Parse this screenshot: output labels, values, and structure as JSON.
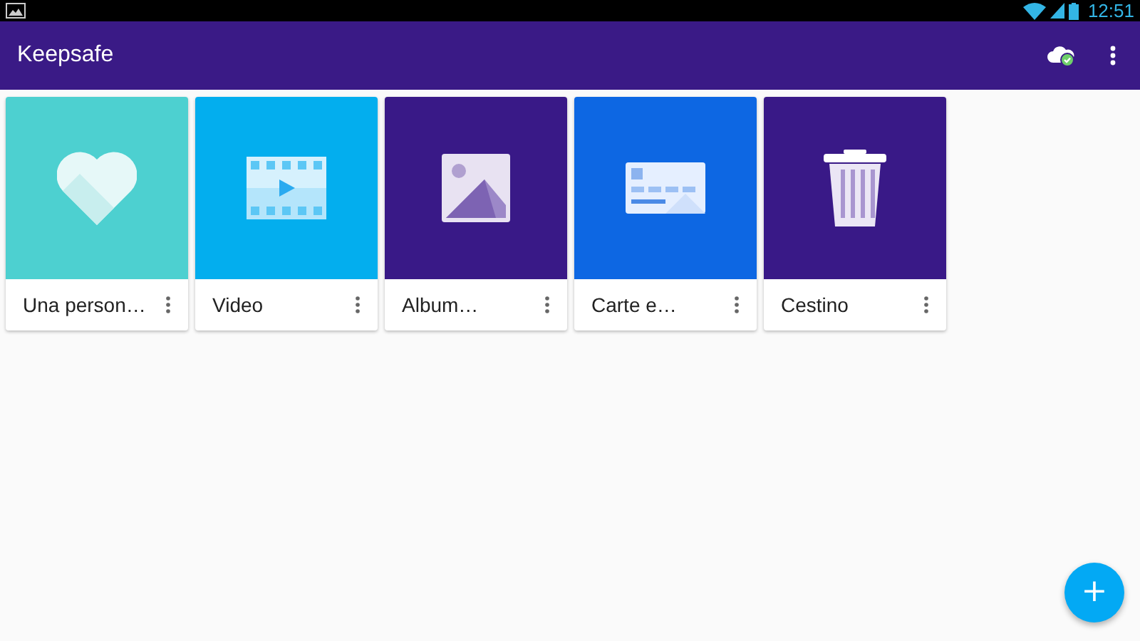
{
  "status_bar": {
    "time": "12:51"
  },
  "app_bar": {
    "title": "Keepsafe"
  },
  "albums": [
    {
      "kind": "heart",
      "title": "Una person…",
      "color": "#4dd0d0"
    },
    {
      "kind": "video",
      "title": "Video",
      "color": "#03aeee"
    },
    {
      "kind": "image",
      "title": "Album…",
      "color": "#391987"
    },
    {
      "kind": "card",
      "title": "Carte e…",
      "color": "#0d67e3"
    },
    {
      "kind": "trash",
      "title": "Cestino",
      "color": "#391987"
    }
  ],
  "fab": {
    "label": "+"
  }
}
